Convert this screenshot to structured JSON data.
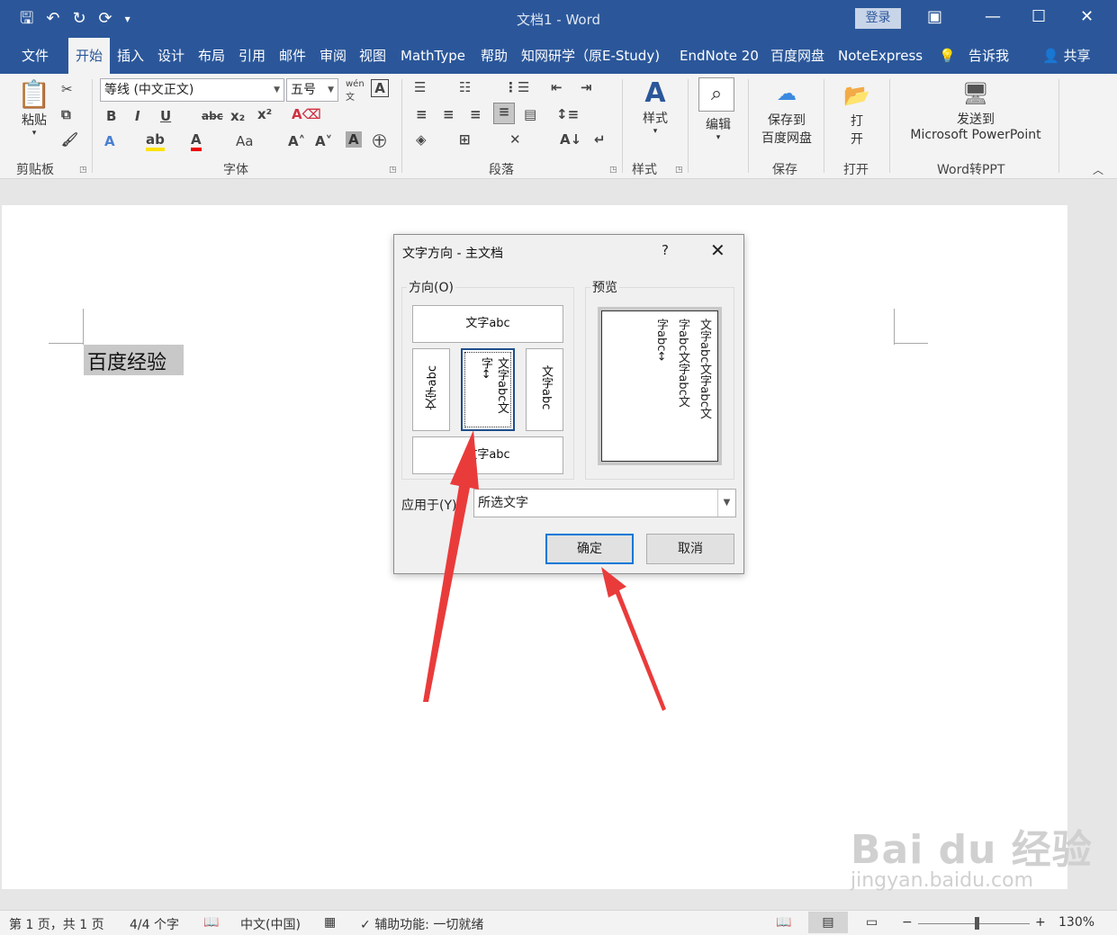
{
  "titlebar": {
    "title": "文档1  -  Word",
    "login": "登录",
    "qat_icons": [
      "save-icon",
      "undo-icon",
      "redo-icon",
      "refresh-icon",
      "customize-icon"
    ]
  },
  "menubar": {
    "tabs": [
      "文件",
      "开始",
      "插入",
      "设计",
      "布局",
      "引用",
      "邮件",
      "审阅",
      "视图",
      "MathType",
      "帮助",
      "知网研学（原E-Study)",
      "EndNote 20",
      "百度网盘",
      "NoteExpress",
      "告诉我",
      "共享"
    ],
    "active_tab": "开始"
  },
  "ribbon": {
    "clipboard": {
      "paste": "粘贴",
      "label": "剪贴板"
    },
    "font": {
      "font_name": "等线 (中文正文)",
      "font_size": "五号",
      "label": "字体",
      "phonetic_hint": "wén"
    },
    "paragraph": {
      "label": "段落"
    },
    "styles": {
      "button": "样式",
      "label": "样式"
    },
    "editing": {
      "button": "编辑"
    },
    "save": {
      "button_line1": "保存到",
      "button_line2": "百度网盘",
      "label": "保存"
    },
    "open": {
      "button_line1": "打",
      "button_line2": "开",
      "label": "打开"
    },
    "ppt": {
      "button_line1": "发送到",
      "button_line2": "Microsoft PowerPoint",
      "label": "Word转PPT"
    }
  },
  "document": {
    "text": "百度经验"
  },
  "dialog": {
    "title": "文字方向 - 主文档",
    "help": "?",
    "direction_label": "方向(O)",
    "preview_label": "预览",
    "options": {
      "horizontal": "文字abc",
      "vertical_left": "文字abc",
      "vertical_selected_col1": "文字abc文",
      "vertical_selected_col2": "字↔",
      "vertical_right": "文字abc",
      "horizontal_bottom": "文字abc"
    },
    "preview_text": [
      "文字abc文字abc文",
      "字abc文字abc文",
      "字abc↔"
    ],
    "apply_label": "应用于(Y)",
    "apply_value": "所选文字",
    "ok": "确定",
    "cancel": "取消"
  },
  "statusbar": {
    "page": "第 1 页，共 1 页",
    "words": "4/4 个字",
    "language": "中文(中国)",
    "accessibility": "辅助功能: 一切就绪",
    "zoom": "130%",
    "zoom_minus": "−",
    "zoom_plus": "+"
  },
  "watermark": {
    "big": "Bai du 经验",
    "small": "jingyan.baidu.com"
  },
  "colors": {
    "accent": "#2b579a",
    "arrow": "#ea3b3b",
    "dialog_primary": "#0078d7"
  }
}
